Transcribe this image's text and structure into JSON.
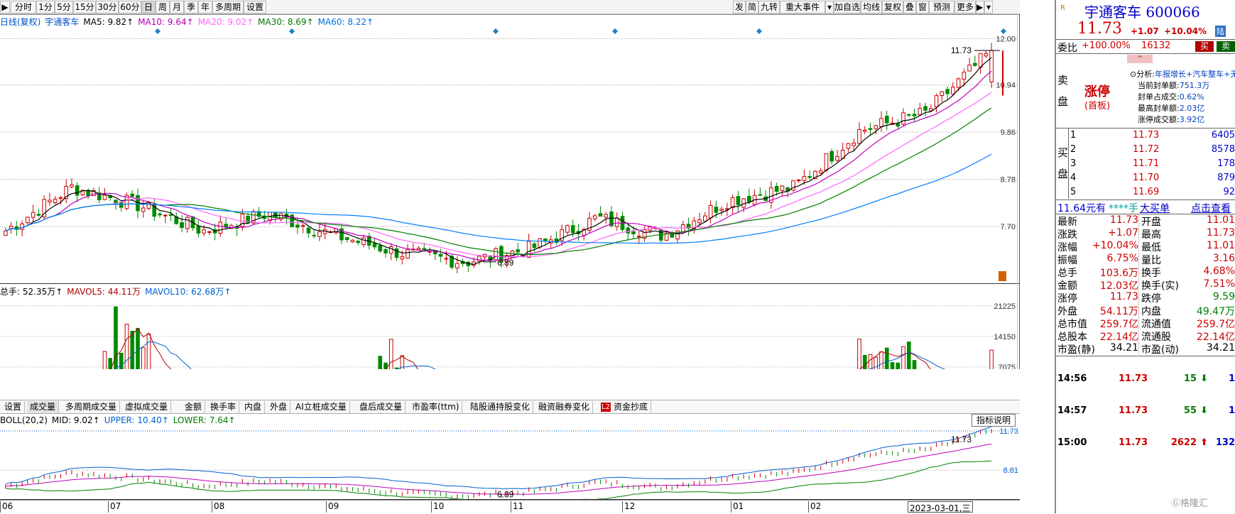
{
  "toolbar": {
    "left_items": [
      "分时",
      "1分",
      "5分",
      "15分",
      "30分",
      "60分",
      "日",
      "周",
      "月",
      "季",
      "年",
      "多周期",
      "设置"
    ],
    "active": "日",
    "right_items": [
      "发",
      "简",
      "九转",
      "重大事件",
      "加自选",
      "均线",
      "复权",
      "叠",
      "窗",
      "预测",
      "更多"
    ]
  },
  "kline_legend": {
    "label": "日线(复权)",
    "name": "宇通客车",
    "ma5": "MA5: 9.82↑",
    "ma10": "MA10: 9.64↑",
    "ma20": "MA20: 9.02↑",
    "ma30": "MA30: 8.69↑",
    "ma60": "MA60: 8.22↑"
  },
  "price_axis": [
    "12.00",
    "10.94",
    "9.86",
    "8.78",
    "7.70"
  ],
  "price_annotations": {
    "high": "11.73",
    "low": "6.89"
  },
  "vol_legend": {
    "total": "总手: 52.35万↑",
    "mavol5": "MAVOL5: 44.11万",
    "mavol10": "MAVOL10: 62.68万↑"
  },
  "vol_axis": [
    "21225",
    "14150",
    "7075"
  ],
  "vol_unit": "X100",
  "tabs": [
    "设置",
    "成交量",
    "多周期成交量",
    "虚拟成交量",
    "金额",
    "换手率",
    "内盘",
    "外盘",
    "AI立桩成交量",
    "盘后成交量",
    "市盈率(ttm)",
    "陆股通持股变化",
    "融资融券变化",
    "资金抄底"
  ],
  "active_tab": "成交量",
  "tab_badge": "L2",
  "boll_legend": {
    "label": "BOLL(20,2)",
    "mid": "MID: 9.02↑",
    "upper": "UPPER: 10.40↑",
    "lower": "LOWER: 7.64↑"
  },
  "boll_axis": [
    "11.73",
    "8.81"
  ],
  "boll_note_button": "指标说明",
  "boll_annotations": {
    "high": "11.73",
    "low": "6.89"
  },
  "months": [
    "06",
    "07",
    "08",
    "09",
    "10",
    "11",
    "12",
    "01",
    "02",
    "03"
  ],
  "cursor_date": "2023-03-01,三",
  "quote": {
    "badge": "R",
    "name": "宇通客车",
    "code": "600066",
    "price": "11.73",
    "change": "+1.07",
    "change_pct": "+10.04%",
    "exchange_tag": "陆",
    "weibi_label": "委比",
    "weibi": "+100.00%",
    "weicha": "16132",
    "buy_btn": "买",
    "sell_btn": "卖",
    "sell_side_label": "卖盘",
    "buy_side_label": "买盘",
    "limit_title": "涨停",
    "limit_sub": "(首板)",
    "analysis_label": "分析:",
    "analysis_text": "年报增长+汽车整车+无人",
    "limit_stats": [
      {
        "label": "当前封单额:",
        "value": "751.3万"
      },
      {
        "label": "封单占成交:",
        "value": "0.62%"
      },
      {
        "label": "最高封单额:",
        "value": "2.03亿"
      },
      {
        "label": "涨停成交额:",
        "value": "3.92亿"
      }
    ],
    "bids": [
      {
        "level": "1",
        "price": "11.73",
        "vol": "6405"
      },
      {
        "level": "2",
        "price": "11.72",
        "vol": "8578"
      },
      {
        "level": "3",
        "price": "11.71",
        "vol": "178"
      },
      {
        "level": "4",
        "price": "11.70",
        "vol": "879"
      },
      {
        "level": "5",
        "price": "11.69",
        "vol": "92"
      }
    ],
    "ticker": {
      "a": "11.64元有",
      "b": "****手",
      "c": "大买单",
      "d": "点击查看"
    },
    "stats": [
      {
        "l1": "最新",
        "v1": "11.73",
        "l2": "开盘",
        "v2": "11.01",
        "c1": "red",
        "c2": "red"
      },
      {
        "l1": "涨跌",
        "v1": "+1.07",
        "l2": "最高",
        "v2": "11.73",
        "c1": "red",
        "c2": "red"
      },
      {
        "l1": "涨幅",
        "v1": "+10.04%",
        "l2": "最低",
        "v2": "11.01",
        "c1": "red",
        "c2": "red"
      },
      {
        "l1": "振幅",
        "v1": "6.75%",
        "l2": "量比",
        "v2": "3.16",
        "c1": "red",
        "c2": "red"
      },
      {
        "l1": "总手",
        "v1": "103.6万",
        "l2": "换手",
        "v2": "4.68%",
        "c1": "red",
        "c2": "red"
      },
      {
        "l1": "金额",
        "v1": "12.03亿",
        "l2": "换手(实)",
        "v2": "7.51%",
        "c1": "red",
        "c2": "red"
      },
      {
        "l1": "涨停",
        "v1": "11.73",
        "l2": "跌停",
        "v2": "9.59",
        "c1": "red",
        "c2": "green"
      },
      {
        "l1": "外盘",
        "v1": "54.11万",
        "l2": "内盘",
        "v2": "49.47万",
        "c1": "red",
        "c2": "green"
      },
      {
        "l1": "总市值",
        "v1": "259.7亿",
        "l2": "流通值",
        "v2": "259.7亿",
        "c1": "red",
        "c2": "red"
      },
      {
        "l1": "总股本",
        "v1": "22.14亿",
        "l2": "流通股",
        "v2": "22.14亿",
        "c1": "red",
        "c2": "red"
      },
      {
        "l1": "市盈(静)",
        "v1": "34.21",
        "l2": "市盈(动)",
        "v2": "34.21",
        "c1": "black",
        "c2": "black"
      }
    ],
    "trades": [
      {
        "time": "14:56",
        "price": "11.73",
        "vol": "15",
        "dir": "down",
        "n": "1"
      },
      {
        "time": "14:57",
        "price": "11.73",
        "vol": "55",
        "dir": "down",
        "n": "1"
      },
      {
        "time": "15:00",
        "price": "11.73",
        "vol": "2622",
        "dir": "up",
        "n": "132"
      }
    ],
    "watermark": "格隆汇"
  },
  "chart_data": {
    "type": "candlestick",
    "title": "宇通客车 日线(复权)",
    "x_range": [
      "2022-06",
      "2023-03-01"
    ],
    "ylim": [
      6.5,
      12.2
    ],
    "price_path": [
      {
        "x": "2022-06",
        "y": 7.6
      },
      {
        "x": "2022-07",
        "y": 8.6
      },
      {
        "x": "2022-07-mid",
        "y": 8.2
      },
      {
        "x": "2022-08",
        "y": 7.6
      },
      {
        "x": "2022-08-mid",
        "y": 8.0
      },
      {
        "x": "2022-09",
        "y": 7.5
      },
      {
        "x": "2022-10",
        "y": 7.1
      },
      {
        "x": "2022-10-end",
        "y": 6.89
      },
      {
        "x": "2022-11",
        "y": 7.2
      },
      {
        "x": "2022-12",
        "y": 7.9
      },
      {
        "x": "2023-01",
        "y": 7.5
      },
      {
        "x": "2023-01-end",
        "y": 8.3
      },
      {
        "x": "2023-02",
        "y": 8.6
      },
      {
        "x": "2023-02-mid",
        "y": 9.9
      },
      {
        "x": "2023-02-end",
        "y": 10.3
      },
      {
        "x": "2023-03-01",
        "y": 11.73
      }
    ],
    "series": [
      {
        "name": "MA5",
        "last": 9.82,
        "color": "#000000"
      },
      {
        "name": "MA10",
        "last": 9.64,
        "color": "#c000c0"
      },
      {
        "name": "MA20",
        "last": 9.02,
        "color": "#ff66ff"
      },
      {
        "name": "MA30",
        "last": 8.69,
        "color": "#008000"
      },
      {
        "name": "MA60",
        "last": 8.22,
        "color": "#0080ff"
      }
    ],
    "volume": {
      "total_last": "52.35万",
      "mavol5": "44.11万",
      "mavol10": "62.68万",
      "ylim": [
        0,
        21225
      ]
    },
    "boll": {
      "mid": 9.02,
      "upper": 10.4,
      "lower": 7.64
    }
  }
}
